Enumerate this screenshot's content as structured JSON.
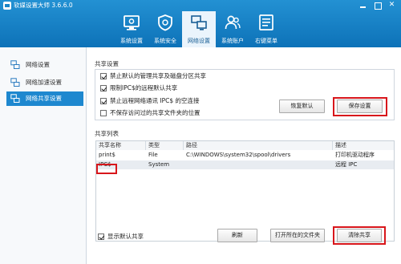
{
  "window": {
    "title": "软媒设置大师 3.6.6.0"
  },
  "tabs": [
    {
      "label": "系统设置"
    },
    {
      "label": "系统安全"
    },
    {
      "label": "网络设置"
    },
    {
      "label": "系统账户"
    },
    {
      "label": "右键菜单"
    }
  ],
  "active_tab": "网络设置",
  "sidebar": {
    "items": [
      {
        "label": "网络设置"
      },
      {
        "label": "网络加速设置"
      },
      {
        "label": "网络共享设置"
      }
    ],
    "active": "网络共享设置"
  },
  "share_settings": {
    "title": "共享设置",
    "options": [
      {
        "label": "禁止默认的管理共享及磁盘分区共享",
        "checked": true
      },
      {
        "label": "限制IPC$的远程默认共享",
        "checked": true
      },
      {
        "label": "禁止远程网络通讯 IPC$ 的空连接",
        "checked": true
      },
      {
        "label": "不保存访问过的共享文件夹的位置",
        "checked": false
      }
    ],
    "restore_button": "恢复默认",
    "save_button": "保存设置"
  },
  "share_list": {
    "title": "共享列表",
    "columns": [
      "共享名称",
      "类型",
      "路径",
      "描述"
    ],
    "rows": [
      {
        "name": "print$",
        "type": "File",
        "path": "C:\\WINDOWS\\system32\\spool\\drivers",
        "desc": "打印机驱动程序"
      },
      {
        "name": "IPC$",
        "type": "System",
        "path": "",
        "desc": "远程 IPC"
      }
    ],
    "show_default_label": "显示默认共享",
    "show_default_checked": true,
    "refresh_button": "刷新",
    "open_folder_button": "打开所在的文件夹",
    "clear_button": "清除共享"
  },
  "colors": {
    "header": "#1a86c8",
    "accent": "#1e88cf",
    "highlight": "#d8161b"
  }
}
